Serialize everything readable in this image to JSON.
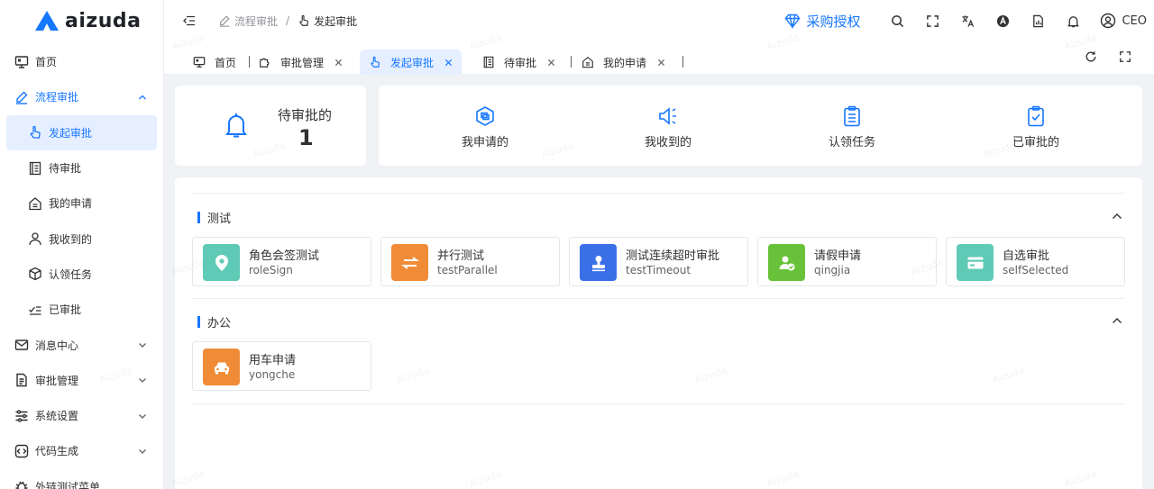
{
  "brand": {
    "name": "aizuda",
    "color": "#1677ff"
  },
  "watermark": "Aizuda",
  "sidebar": {
    "items": [
      {
        "label": "首页",
        "icon": "monitor-icon"
      },
      {
        "label": "流程审批",
        "icon": "pen-icon",
        "expanded": true
      },
      {
        "label": "发起审批",
        "icon": "hand-pointer-icon",
        "sub": true,
        "selected": true
      },
      {
        "label": "待审批",
        "icon": "document-list-icon",
        "sub": true
      },
      {
        "label": "我的申请",
        "icon": "home-doc-icon",
        "sub": true
      },
      {
        "label": "我收到的",
        "icon": "user-icon",
        "sub": true
      },
      {
        "label": "认领任务",
        "icon": "cube-icon",
        "sub": true
      },
      {
        "label": "已审批",
        "icon": "check-list-icon",
        "sub": true
      },
      {
        "label": "消息中心",
        "icon": "mail-icon"
      },
      {
        "label": "审批管理",
        "icon": "file-text-icon"
      },
      {
        "label": "系统设置",
        "icon": "sliders-icon"
      },
      {
        "label": "代码生成",
        "icon": "code-icon"
      },
      {
        "label": "外链测试菜单",
        "icon": "bug-icon"
      }
    ]
  },
  "header": {
    "breadcrumb": [
      "流程审批",
      "发起审批"
    ],
    "breadcrumb_sep": "/",
    "buy_label": "采购授权",
    "user": "CEO"
  },
  "tabs": [
    {
      "label": "首页",
      "closable": false
    },
    {
      "label": "审批管理",
      "closable": true
    },
    {
      "label": "发起审批",
      "closable": true,
      "active": true
    },
    {
      "label": "待审批",
      "closable": true
    },
    {
      "label": "我的申请",
      "closable": true
    }
  ],
  "stats": {
    "pending_title": "待审批的",
    "pending_count": "1",
    "quick_actions": [
      {
        "label": "我申请的",
        "icon": "apply-icon"
      },
      {
        "label": "我收到的",
        "icon": "speaker-icon"
      },
      {
        "label": "认领任务",
        "icon": "clipboard-icon"
      },
      {
        "label": "已审批的",
        "icon": "clipboard-check-icon"
      }
    ]
  },
  "groups": [
    {
      "title": "测试",
      "items": [
        {
          "name": "角色会签测试",
          "key": "roleSign",
          "color": "#5fcab5",
          "icon": "location-pin-icon"
        },
        {
          "name": "并行测试",
          "key": "testParallel",
          "color": "#f08c38",
          "icon": "swap-arrows-icon"
        },
        {
          "name": "测试连续超时审批",
          "key": "testTimeout",
          "color": "#3b6fe8",
          "icon": "stamp-icon"
        },
        {
          "name": "请假申请",
          "key": "qingjia",
          "color": "#67c23a",
          "icon": "user-check-icon"
        },
        {
          "name": "自选审批",
          "key": "selfSelected",
          "color": "#5fcab5",
          "icon": "card-icon"
        }
      ]
    },
    {
      "title": "办公",
      "items": [
        {
          "name": "用车申请",
          "key": "yongche",
          "color": "#f08c38",
          "icon": "car-icon"
        }
      ]
    }
  ]
}
